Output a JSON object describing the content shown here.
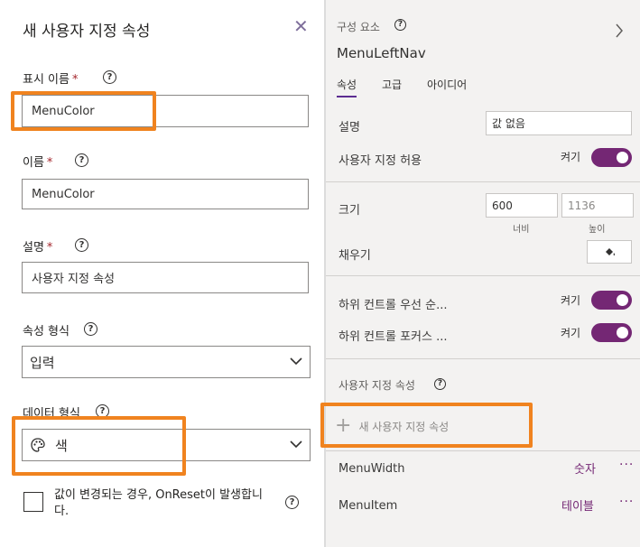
{
  "panel": {
    "title": "새 사용자 지정 속성",
    "display_name": {
      "label": "표시 이름",
      "required": "*",
      "value": "MenuColor"
    },
    "name": {
      "label": "이름",
      "required": "*",
      "value": "MenuColor"
    },
    "description": {
      "label": "설명",
      "required": "*",
      "value": "사용자 지정 속성"
    },
    "property_type": {
      "label": "속성 형식",
      "value": "입력"
    },
    "data_type": {
      "label": "데이터 형식",
      "value": "색"
    },
    "onreset": {
      "label": "값이 변경되는 경우, OnReset이 발생합니",
      "label_line2": "다.",
      "checked": false
    },
    "help_glyph": "?"
  },
  "component": {
    "section_label": "구성 요소",
    "name": "MenuLeftNav",
    "tabs": [
      {
        "label": "속성",
        "active": true
      },
      {
        "label": "고급",
        "active": false
      },
      {
        "label": "아이디어",
        "active": false
      }
    ],
    "description": {
      "label": "설명",
      "value": "값 없음"
    },
    "allow_custom": {
      "label": "사용자 지정 허용",
      "state": "켜기",
      "on": true
    },
    "size": {
      "label": "크기",
      "width": "600",
      "height": "1136",
      "width_label": "너비",
      "height_label": "높이"
    },
    "fill": {
      "label": "채우기"
    },
    "child_tab_order": {
      "label": "하위 컨트롤 우선 순...",
      "state": "켜기",
      "on": true
    },
    "child_focus": {
      "label": "하위 컨트롤 포커스 ...",
      "state": "켜기",
      "on": true
    },
    "custom_props": {
      "label": "사용자 지정 속성",
      "add_label": "새 사용자 지정 속성",
      "items": [
        {
          "name": "MenuWidth",
          "type": "숫자"
        },
        {
          "name": "MenuItem",
          "type": "테이블"
        }
      ]
    }
  },
  "colors": {
    "accent": "#742774",
    "highlight": "#f0831f",
    "required": "#a4262c"
  }
}
